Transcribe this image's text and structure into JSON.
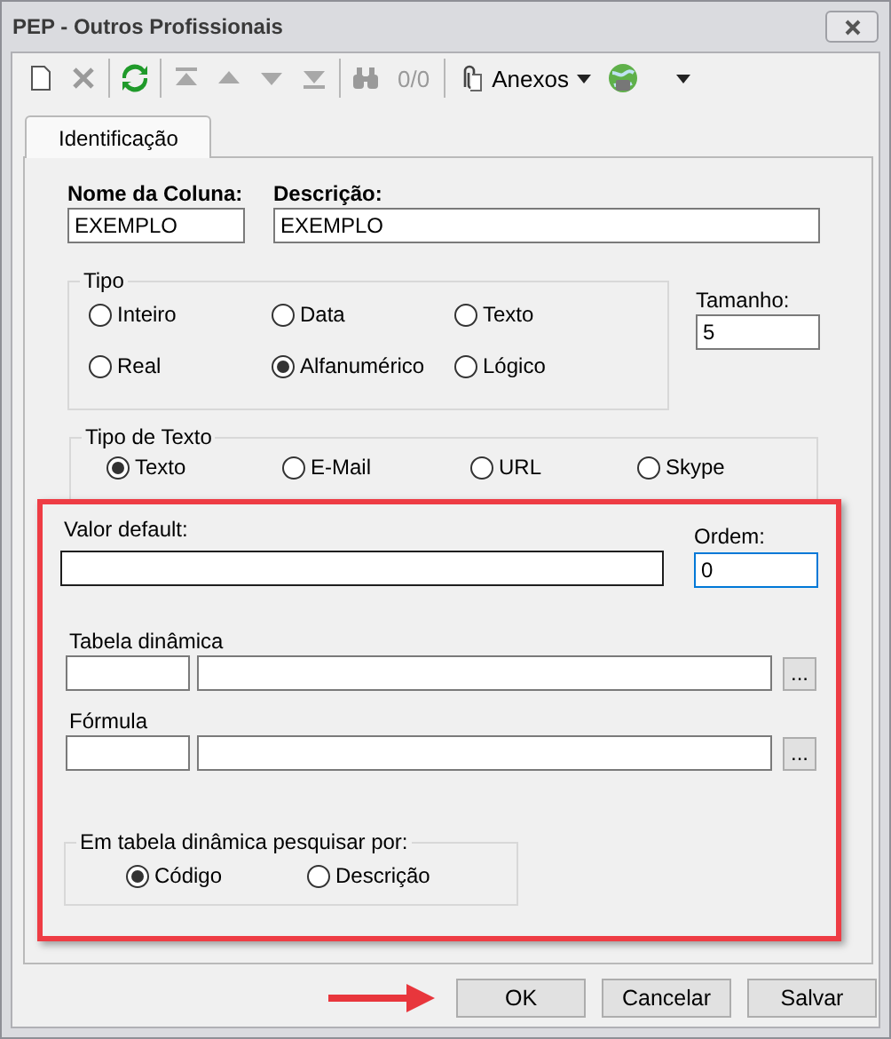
{
  "window": {
    "title": "PEP - Outros Profissionais"
  },
  "toolbar": {
    "counter": "0/0",
    "attachments_label": "Anexos"
  },
  "tabs": [
    {
      "label": "Identificação",
      "selected": true
    }
  ],
  "column_name": {
    "label": "Nome da Coluna:",
    "value": "EXEMPLO"
  },
  "description": {
    "label": "Descrição:",
    "value": "EXEMPLO"
  },
  "type_group": {
    "title": "Tipo",
    "options": [
      {
        "label": "Inteiro",
        "selected": false
      },
      {
        "label": "Data",
        "selected": false
      },
      {
        "label": "Texto",
        "selected": false
      },
      {
        "label": "Real",
        "selected": false
      },
      {
        "label": "Alfanumérico",
        "selected": true
      },
      {
        "label": "Lógico",
        "selected": false
      }
    ]
  },
  "size": {
    "label": "Tamanho:",
    "value": "5"
  },
  "text_type_group": {
    "title": "Tipo de Texto",
    "options": [
      {
        "label": "Texto",
        "selected": true
      },
      {
        "label": "E-Mail",
        "selected": false
      },
      {
        "label": "URL",
        "selected": false
      },
      {
        "label": "Skype",
        "selected": false
      }
    ]
  },
  "highlight": {
    "shown": true,
    "arrow": true
  },
  "default_value": {
    "label": "Valor default:"
  },
  "order": {
    "label": "Ordem:",
    "value": "0",
    "focused": true
  },
  "dynamic_table": {
    "label": "Tabela dinâmica",
    "browse": "..."
  },
  "formula": {
    "label": "Fórmula",
    "browse": "..."
  },
  "search_group": {
    "title": "Em tabela dinâmica pesquisar por:",
    "options": [
      {
        "label": "Código",
        "selected": true
      },
      {
        "label": "Descrição",
        "selected": false
      }
    ]
  },
  "buttons": [
    {
      "label": "OK"
    },
    {
      "label": "Cancelar"
    },
    {
      "label": "Salvar"
    }
  ]
}
